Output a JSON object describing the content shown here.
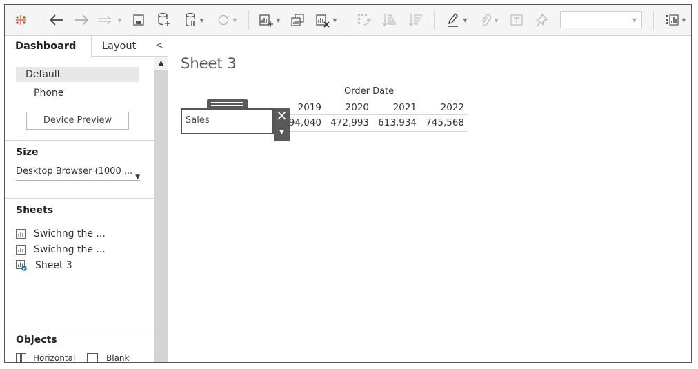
{
  "toolbar": {
    "icons": [
      "tableau-logo-icon",
      "back-arrow-icon",
      "forward-arrow-icon",
      "redirect-icon",
      "save-icon",
      "new-datasource-icon",
      "pause-updates-icon",
      "refresh-icon",
      "new-worksheet-icon",
      "duplicate-sheet-icon",
      "clear-sheet-icon",
      "swap-icon",
      "sort-ascending-icon",
      "sort-descending-icon",
      "highlight-icon",
      "group-icon",
      "label-icon",
      "pin-icon",
      "show-me-icon"
    ],
    "dropdown_value": ""
  },
  "left_pane": {
    "tabs": {
      "dashboard": "Dashboard",
      "layout": "Layout"
    },
    "collapse_glyph": "<",
    "device": {
      "default": "Default",
      "phone": "Phone",
      "preview_button": "Device Preview"
    },
    "size": {
      "title": "Size",
      "value": "Desktop Browser (1000 ..."
    },
    "sheets": {
      "title": "Sheets",
      "items": [
        {
          "label": "Swichng the ...",
          "icon": "bar-chart-icon"
        },
        {
          "label": "Swichng the ...",
          "icon": "bar-chart-icon"
        },
        {
          "label": "Sheet 3",
          "icon": "bar-chart-check-icon"
        }
      ]
    },
    "objects": {
      "title": "Objects",
      "items": [
        {
          "label": "Horizontal",
          "icon": "horizontal-container-icon"
        },
        {
          "label": "Blank",
          "icon": "blank-icon"
        }
      ]
    }
  },
  "canvas": {
    "sheet_title": "Sheet 3",
    "table": {
      "column_dimension": "Order Date",
      "columns": [
        "2019",
        "2020",
        "2021",
        "2022"
      ],
      "row_label": "Sales",
      "values": [
        "94,040",
        "472,993",
        "613,934",
        "745,568"
      ]
    },
    "floating_controls": {
      "close": "×",
      "more": "▼"
    }
  },
  "colors": {
    "toolbar_bg": "#f5f5f5",
    "selection_bg": "#e8e8e8",
    "scrollbar": "#d4d4d4",
    "control_dark": "#5a5a5a",
    "accent_blue": "#1f77b4"
  }
}
